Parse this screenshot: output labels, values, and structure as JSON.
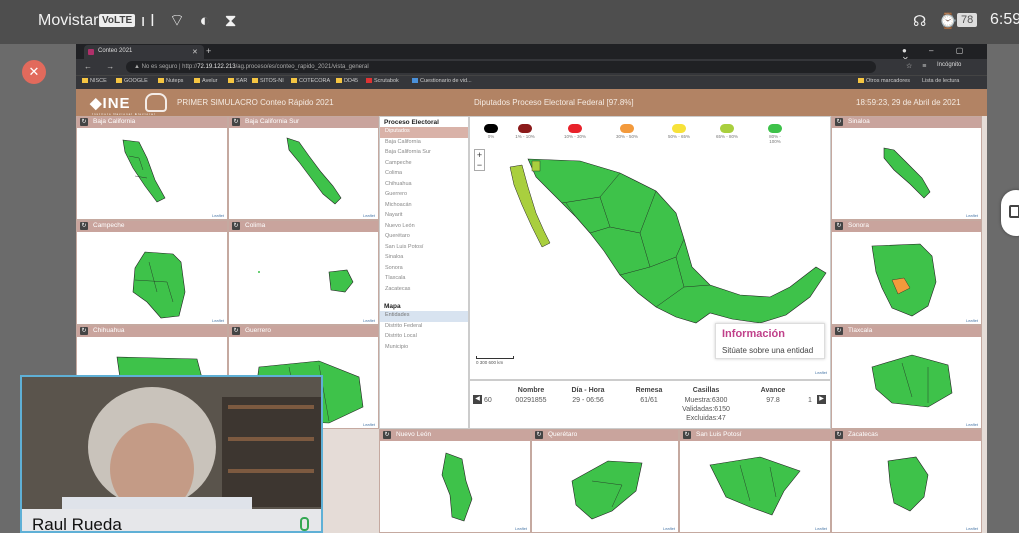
{
  "status_bar": {
    "carrier": "Movistar",
    "volte": "VoLTE",
    "signal_icons": ".ıl ⌔ ◐ ⧗",
    "right_icons": "☊ ⌚",
    "battery": "78",
    "time": "6:59"
  },
  "browser": {
    "tab_title": "Conteo 2021",
    "url_prefix": "▲ No es seguro  |  http://",
    "url_host": "72.19.122.213",
    "url_path": "/ag.proceso/es/conteo_rapido_2021/vista_general",
    "incognito": "Incógnito",
    "bookmarks": [
      "NISCE",
      "GOOGLE",
      "Nuteps",
      "Avelur",
      "SAR",
      "SITOS-NI",
      "COTECORA",
      "DD45",
      "Scrutabok",
      "Cuestionario de vid...",
      "Otros marcadores",
      "Lista de lectura"
    ]
  },
  "header": {
    "logo": "INE",
    "logo_sub": "Instituto Nacional Electoral",
    "title": "PRIMER SIMULACRO Conteo Rápido 2021",
    "center": "Diputados Proceso Electoral Federal [97.8%]",
    "datetime": "18:59:23, 29 de Abril de 2021"
  },
  "left_panels": [
    {
      "title": "Baja California"
    },
    {
      "title": "Baja California Sur"
    },
    {
      "title": "Campeche"
    },
    {
      "title": "Colima"
    },
    {
      "title": "Chihuahua"
    },
    {
      "title": "Guerrero"
    }
  ],
  "bottom_panels": [
    {
      "title": "Nuevo León"
    },
    {
      "title": "Querétaro"
    },
    {
      "title": "San Luis Potosí"
    }
  ],
  "right_panels": [
    {
      "title": "Sinaloa"
    },
    {
      "title": "Sonora"
    },
    {
      "title": "Tlaxcala"
    },
    {
      "title": "Zacatecas"
    }
  ],
  "leaflet_label": "Leaflet",
  "proceso": {
    "heading": "Proceso Electoral",
    "items": [
      "Diputados",
      "Baja California",
      "Baja California Sur",
      "Campeche",
      "Colima",
      "Chihuahua",
      "Guerrero",
      "Michoacán",
      "Nayarit",
      "Nuevo León",
      "Querétaro",
      "San Luis Potosí",
      "Sinaloa",
      "Sonora",
      "Tlaxcala",
      "Zacatecas"
    ],
    "map_heading": "Mapa",
    "map_items": [
      "Entidades",
      "Distrito Federal",
      "Distrito Local",
      "Municipio"
    ]
  },
  "legend": [
    {
      "label": "0%",
      "color": "#000000"
    },
    {
      "label": "1% - 10%",
      "color": "#8b1a1a"
    },
    {
      "label": "10% - 30%",
      "color": "#e8222b"
    },
    {
      "label": "30% - 50%",
      "color": "#f39a3c"
    },
    {
      "label": "50% - 65%",
      "color": "#f7e23a"
    },
    {
      "label": "65% - 80%",
      "color": "#a9cf3e"
    },
    {
      "label": "80% - 100%",
      "color": "#3ec24a"
    }
  ],
  "main_map": {
    "zoom_in": "+",
    "zoom_out": "−",
    "scale_label": "0     300     600 km",
    "info_title": "Información",
    "info_text": "Sitúate sobre una entidad"
  },
  "stats": {
    "prev_count": "60",
    "next_count": "1",
    "nombre_h": "Nombre",
    "nombre_v": "00291855",
    "dia_h": "Día - Hora",
    "dia_v": "29 - 06:56",
    "remesa_h": "Remesa",
    "remesa_v": "61/61",
    "casillas_h": "Casillas",
    "casillas_v1": "Muestra:6300",
    "casillas_v2": "Validadas:6150",
    "casillas_v3": "Excluidas:47",
    "avance_h": "Avance",
    "avance_v": "97.8"
  },
  "webcam": {
    "name": "Raul Rueda"
  },
  "colors": {
    "panel_header": "#c9a49d",
    "ine_header": "#b28364",
    "state_green": "#3ec24a",
    "highlight_orange": "#f39a3c",
    "highlight_yellowgreen": "#a9cf3e"
  }
}
